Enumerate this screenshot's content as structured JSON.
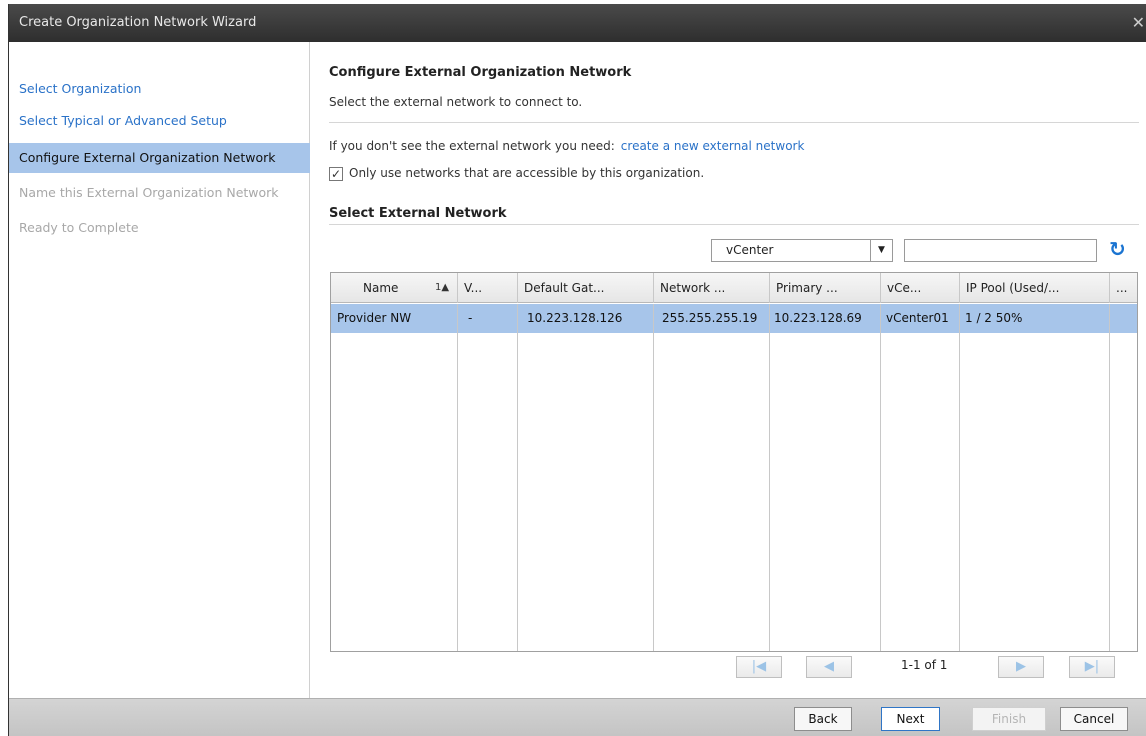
{
  "dialog": {
    "title": "Create Organization Network Wizard",
    "close_glyph": "✕"
  },
  "nav": {
    "items": [
      {
        "label": "Select Organization",
        "state": "link"
      },
      {
        "label": "Select Typical or Advanced Setup",
        "state": "link"
      },
      {
        "label": "Configure External Organization Network",
        "state": "current"
      },
      {
        "label": "Name this External Organization Network",
        "state": "disabled"
      },
      {
        "label": "Ready to Complete",
        "state": "disabled"
      }
    ]
  },
  "main": {
    "title": "Configure External Organization Network",
    "subtitle": "Select the external network to connect to.",
    "info_text": "If you don't see the external network you need:",
    "create_link": "create a new external network",
    "checkbox_label": "Only use networks that are accessible by this organization.",
    "checkbox_checked": true,
    "section_title": "Select External Network"
  },
  "filter": {
    "selected": "vCenter",
    "input_value": ""
  },
  "grid": {
    "columns": [
      "Name",
      "V...",
      "Default Gat...",
      "Network ...",
      "Primary ...",
      "vCe...",
      "IP Pool (Used/...",
      "..."
    ],
    "sort_indicator": "1▲",
    "rows": [
      [
        "Provider NW",
        "-",
        "10.223.128.126",
        "255.255.255.19",
        "10.223.128.69",
        "vCenter01",
        "1 / 2 50%"
      ]
    ],
    "selected_row": 0
  },
  "pager": {
    "info": "1-1 of 1"
  },
  "footer": {
    "back": "Back",
    "next": "Next",
    "finish": "Finish",
    "cancel": "Cancel"
  },
  "colors": {
    "selection": "#a7c5ea",
    "link": "#2a72c8",
    "refresh": "#1b74d1"
  }
}
